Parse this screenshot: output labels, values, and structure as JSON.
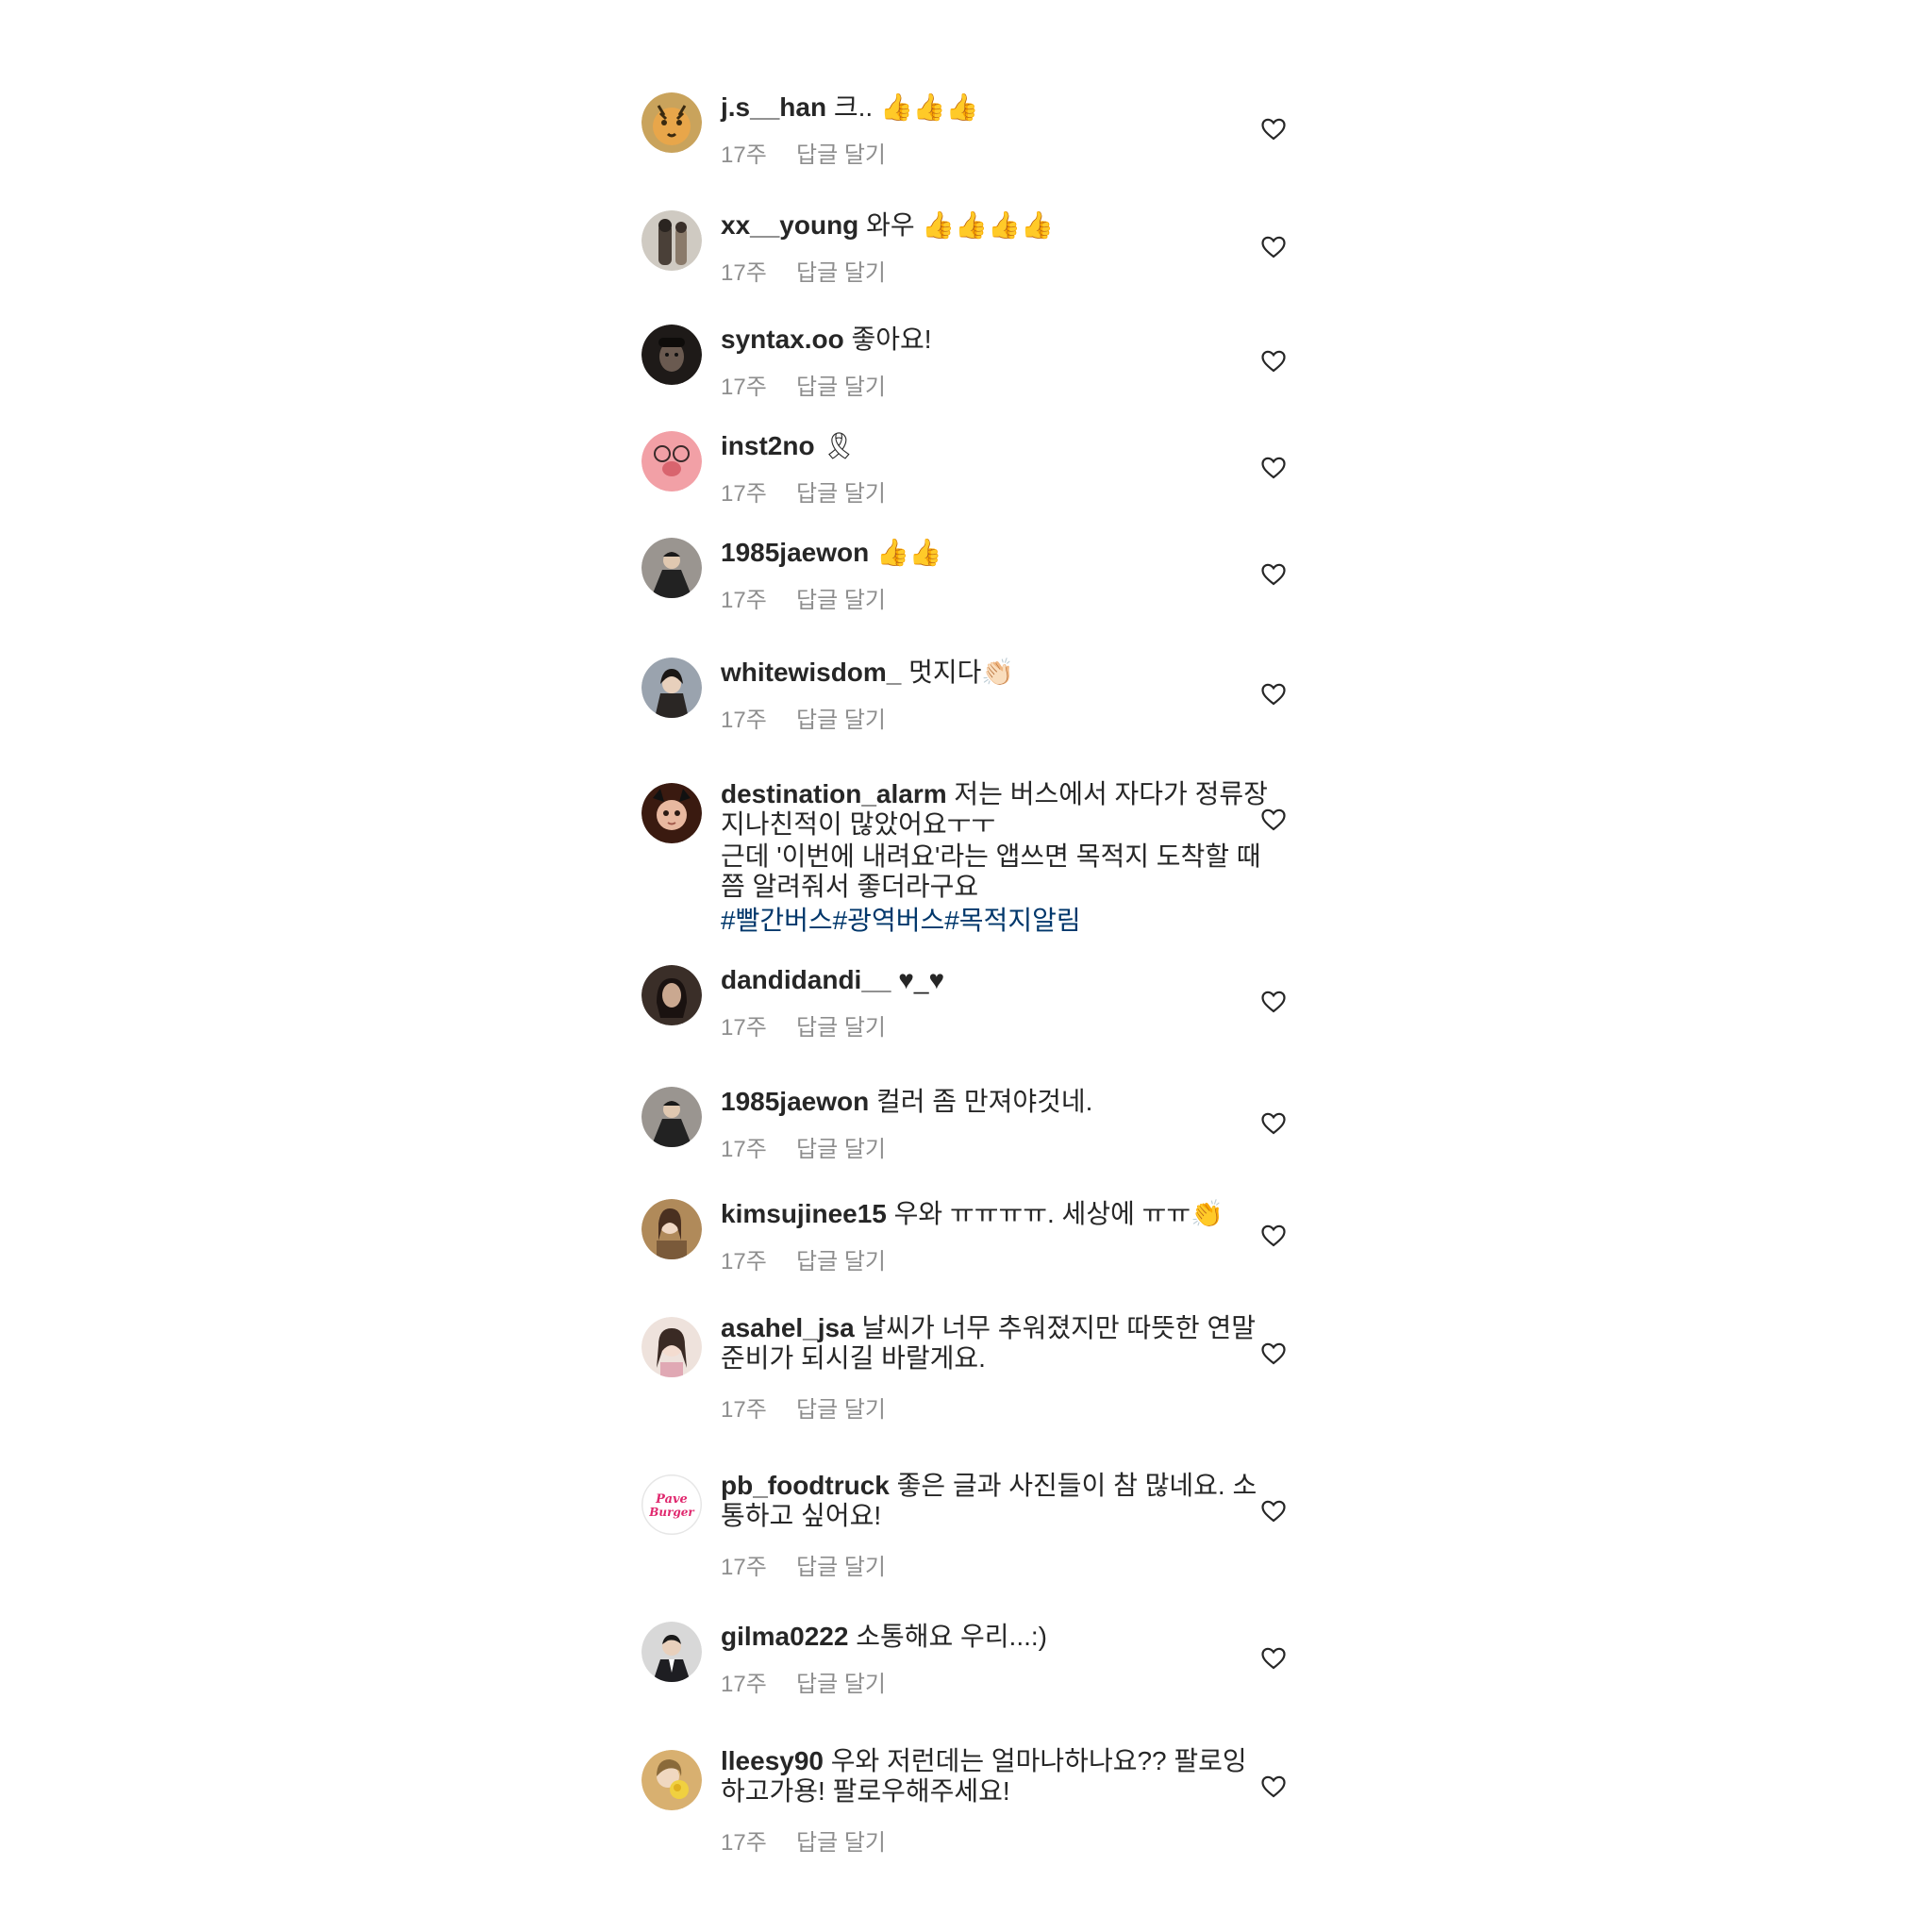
{
  "comments": [
    {
      "username": "j.s__han",
      "text": "크.. 👍👍👍",
      "time": "17주",
      "reply": "답글 달기",
      "avatar_colors": [
        "#c9a35c",
        "#3a2a10"
      ]
    },
    {
      "username": "xx__young",
      "text": "와우 👍👍👍👍",
      "time": "17주",
      "reply": "답글 달기",
      "avatar_colors": [
        "#cfcac2",
        "#4a4038"
      ]
    },
    {
      "username": "syntax.oo",
      "text": "좋아요!",
      "time": "17주",
      "reply": "답글 달기",
      "avatar_colors": [
        "#1e1a18",
        "#6a5a50"
      ]
    },
    {
      "username": "inst2no",
      "text": "🎗",
      "time": "17주",
      "reply": "답글 달기",
      "avatar_colors": [
        "#f2a0a6",
        "#d9646e"
      ]
    },
    {
      "username": "1985jaewon",
      "text": "👍👍",
      "time": "17주",
      "reply": "답글 달기",
      "avatar_colors": [
        "#9a9590",
        "#222222"
      ]
    },
    {
      "username": "whitewisdom_",
      "text": "멋지다👏🏻",
      "time": "17주",
      "reply": "답글 달기",
      "avatar_colors": [
        "#9aa3ae",
        "#2a2624"
      ]
    },
    {
      "username": "destination_alarm",
      "text": "저는 버스에서 자다가 정류장 지나친적이 많았어요ㅜㅜ",
      "text2": "근데 '이번에 내려요'라는 앱쓰면 목적지 도착할 때쯤 알려줘서 좋더라구요",
      "hashtags": "#빨간버스#광역버스#목적지알림",
      "avatar_colors": [
        "#3a1a10",
        "#e8b8a0"
      ]
    },
    {
      "username": "dandidandi__",
      "text": "♥_♥",
      "time": "17주",
      "reply": "답글 달기",
      "avatar_colors": [
        "#3a2e28",
        "#caa890"
      ]
    },
    {
      "username": "1985jaewon",
      "text": "컬러 좀 만져야것네.",
      "time": "17주",
      "reply": "답글 달기",
      "avatar_colors": [
        "#9a9590",
        "#222222"
      ]
    },
    {
      "username": "kimsujinee15",
      "text": "우와 ㅠㅠㅠㅠ.  세상에 ㅠㅠ👏",
      "time": "17주",
      "reply": "답글 달기",
      "avatar_colors": [
        "#b08a5a",
        "#4a3020"
      ]
    },
    {
      "username": "asahel_jsa",
      "text": "날씨가 너무 추워졌지만 따뜻한 연말준비가 되시길 바랄게요.",
      "time": "17주",
      "reply": "답글 달기",
      "avatar_colors": [
        "#eee2dc",
        "#3a2a24"
      ]
    },
    {
      "username": "pb_foodtruck",
      "text": "좋은 글과 사진들이 참 많네요. 소통하고 싶어요!",
      "time": "17주",
      "reply": "답글 달기",
      "avatar_logo": "Pave Burger",
      "avatar_colors": [
        "#ffffff",
        "#e0286e"
      ]
    },
    {
      "username": "gilma0222",
      "text": "소통해요 우리...:)",
      "time": "17주",
      "reply": "답글 달기",
      "avatar_colors": [
        "#d8d8d8",
        "#1e1e22"
      ]
    },
    {
      "username": "lleesy90",
      "text": "우와 저런데는 얼마나하나요?? 팔로잉 하고가용! 팔로우해주세요!",
      "time": "17주",
      "reply": "답글 달기",
      "avatar_colors": [
        "#d8b070",
        "#f0d040"
      ]
    }
  ],
  "icons": {
    "like": "heart-outline-icon"
  }
}
